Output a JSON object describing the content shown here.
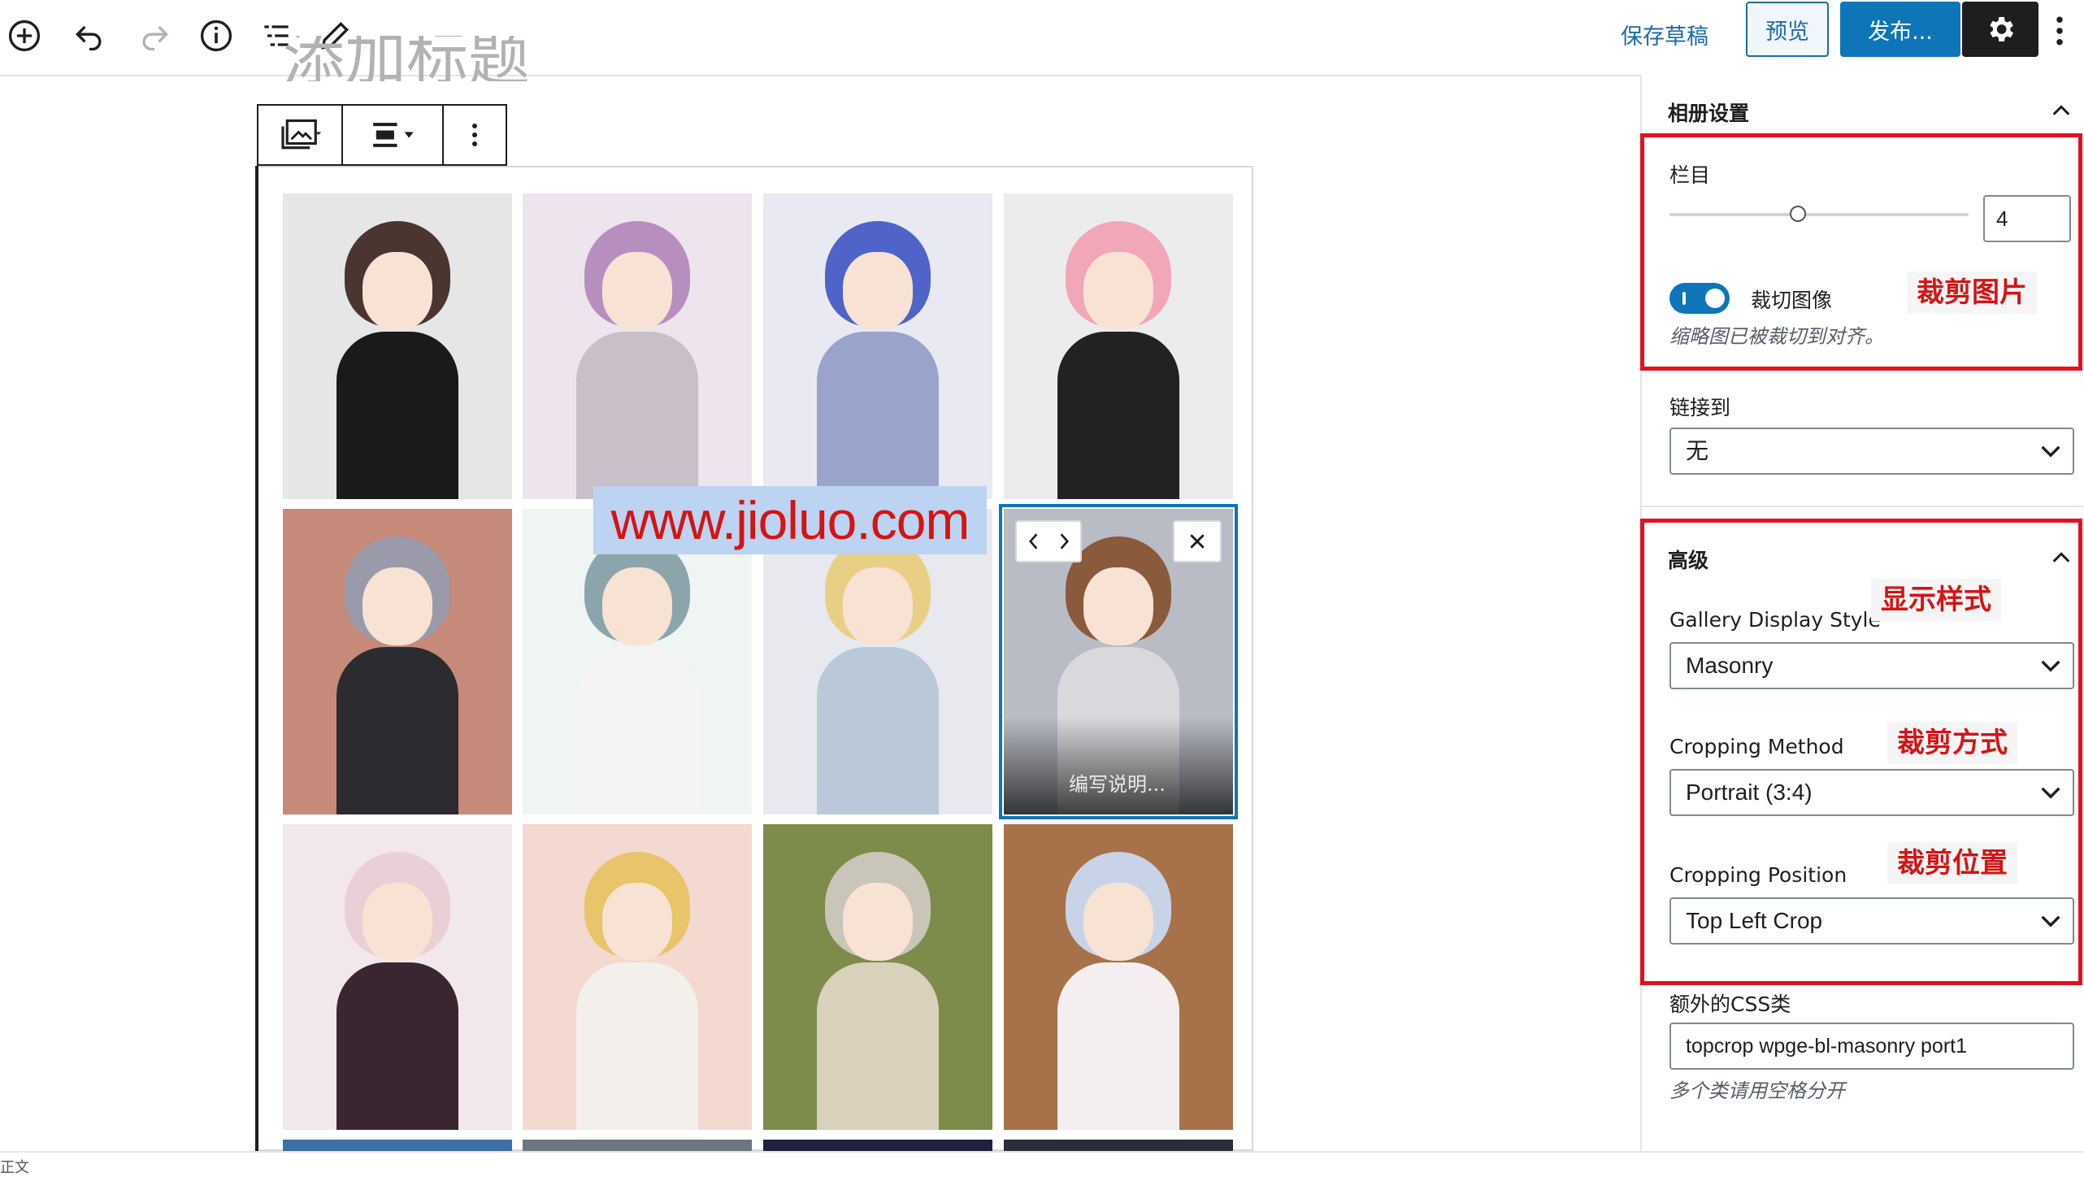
{
  "toolbar": {
    "save_draft": "保存草稿",
    "preview": "预览",
    "publish": "发布...",
    "icons": [
      "add-block-icon",
      "undo-icon",
      "redo-icon",
      "info-icon",
      "list-view-icon",
      "edit-pencil-icon",
      "gear-icon",
      "more-vertical-icon"
    ]
  },
  "editor": {
    "title_fragment": "添加标题",
    "block_toolbar_icons": [
      "gallery-icon",
      "align-center-icon",
      "more-vertical-icon"
    ],
    "selected_caption_placeholder": "编写说明...",
    "watermark": "www.jioluo.com",
    "bottom_status": "正文",
    "tile_colors": [
      {
        "bg": "#e6e6e6",
        "hair": "#4a3530",
        "body": "#1a1a1a"
      },
      {
        "bg": "#eee4ee",
        "hair": "#b78fbf",
        "body": "#c9bfc9"
      },
      {
        "bg": "#e8e9f2",
        "hair": "#4f63c8",
        "body": "#9aa3c9"
      },
      {
        "bg": "#ececec",
        "hair": "#f1a7b8",
        "body": "#222222"
      },
      {
        "bg": "#c58a7a",
        "hair": "#9b9aab",
        "body": "#2b2b30"
      },
      {
        "bg": "#eef5f3",
        "hair": "#8ca4ab",
        "body": "#f4f4f4"
      },
      {
        "bg": "#e7e9ee",
        "hair": "#e9cf85",
        "body": "#b9c9d9"
      },
      {
        "bg": "#b9bcc4",
        "hair": "#8a5a3c",
        "body": "#d9d9dd"
      },
      {
        "bg": "#f2e7ea",
        "hair": "#ead0d6",
        "body": "#3a2630"
      },
      {
        "bg": "#f3d9cf",
        "hair": "#e8c46a",
        "body": "#f3f0ec"
      },
      {
        "bg": "#7d8c4a",
        "hair": "#c9c5b8",
        "body": "#d9d1bb"
      },
      {
        "bg": "#a7724a",
        "hair": "#c9d3e8",
        "body": "#f4eef0"
      }
    ]
  },
  "sidebar": {
    "gallery_settings_title": "相册设置",
    "columns_label": "栏目",
    "columns_value": "4",
    "columns_range": {
      "min": 1,
      "max": 8
    },
    "crop_toggle_label": "裁切图像",
    "crop_toggle_on": true,
    "crop_help": "缩略图已被裁切到对齐。",
    "link_to_label": "链接到",
    "link_to_value": "无",
    "advanced_title": "高级",
    "display_style_label": "Gallery Display Style",
    "display_style_value": "Masonry",
    "cropping_method_label": "Cropping Method",
    "cropping_method_value": "Portrait (3:4)",
    "cropping_position_label": "Cropping Position",
    "cropping_position_value": "Top Left Crop",
    "css_class_label": "额外的CSS类",
    "css_class_value": "topcrop wpge-bl-masonry port1",
    "css_class_help": "多个类请用空格分开"
  },
  "annotations": {
    "crop_image": "裁剪图片",
    "display_style": "显示样式",
    "crop_method": "裁剪方式",
    "crop_position": "裁剪位置",
    "highlight_color": "#e3111b"
  }
}
